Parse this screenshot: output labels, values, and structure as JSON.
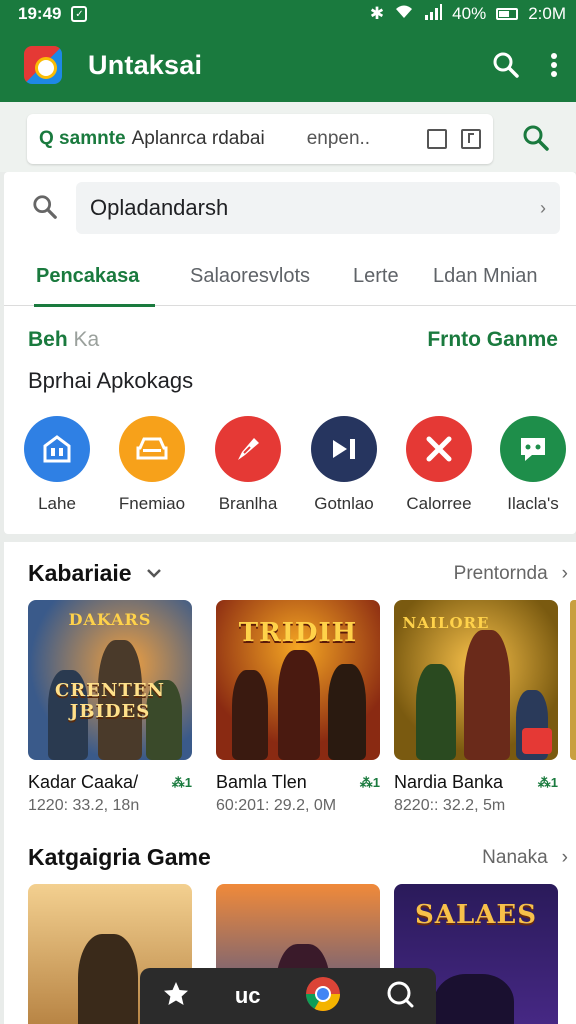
{
  "status_bar": {
    "time": "19:49",
    "battery": "40%",
    "clock_right": "2:0M"
  },
  "app_bar": {
    "title": "Untaksai"
  },
  "search_strip": {
    "label": "Q samnte",
    "hint": "Aplanrca rdabai",
    "sub": "enpen.."
  },
  "search_field": {
    "value": "Opladandarsh"
  },
  "tabs": [
    {
      "label": "Pencakasa"
    },
    {
      "label": "Salaoresvlots"
    },
    {
      "label": "Lerte"
    },
    {
      "label": "Ldan Mnian"
    }
  ],
  "section": {
    "left_label": "Beh",
    "left_muted": "Ka",
    "right_label": "Frnto Ganme",
    "subheading": "Bprhai Apkokags"
  },
  "categories": [
    {
      "label": "Lahe",
      "color": "#2f80e4",
      "icon": "building-icon"
    },
    {
      "label": "Fnemiao",
      "color": "#f7a11a",
      "icon": "car-icon"
    },
    {
      "label": "Branlha",
      "color": "#e53935",
      "icon": "brush-icon"
    },
    {
      "label": "Gotnlao",
      "color": "#26355f",
      "icon": "play-icon"
    },
    {
      "label": "Calorree",
      "color": "#e53935",
      "icon": "tools-icon"
    },
    {
      "label": "Ilacla's",
      "color": "#1e8e4a",
      "icon": "chat-icon"
    }
  ],
  "row1": {
    "title": "Kabariaie",
    "more": "Prentornda",
    "games": [
      {
        "name": "Kadar Caaka/",
        "meta": "1220: 33.2, 18n",
        "badge": "⁂1",
        "art": "DAKARS",
        "art2": "CRENTEN JBIDES",
        "bg": "#3a5a8a"
      },
      {
        "name": "Bamla Tlen",
        "meta": "60:201: 29.2, 0M",
        "badge": "⁂1",
        "art": "TRIDIH",
        "art2": "",
        "bg": "#8a2a12"
      },
      {
        "name": "Nardia Banka",
        "meta": "8220:: 32.2, 5m",
        "badge": "⁂1",
        "art": "NAILORE",
        "art2": "",
        "bg": "#7a5a10"
      }
    ]
  },
  "row2": {
    "title": "Katgaigria Game",
    "more": "Nanaka",
    "games": [
      {
        "name": "",
        "meta": "",
        "art": "",
        "bg": "#b07a3a"
      },
      {
        "name": "",
        "meta": "",
        "art": "",
        "bg": "#2a4a9a"
      },
      {
        "name": "",
        "meta": "",
        "art": "SALAES",
        "bg": "#4a2a8a"
      }
    ]
  },
  "bottom_nav": {
    "center_text": "uc"
  }
}
